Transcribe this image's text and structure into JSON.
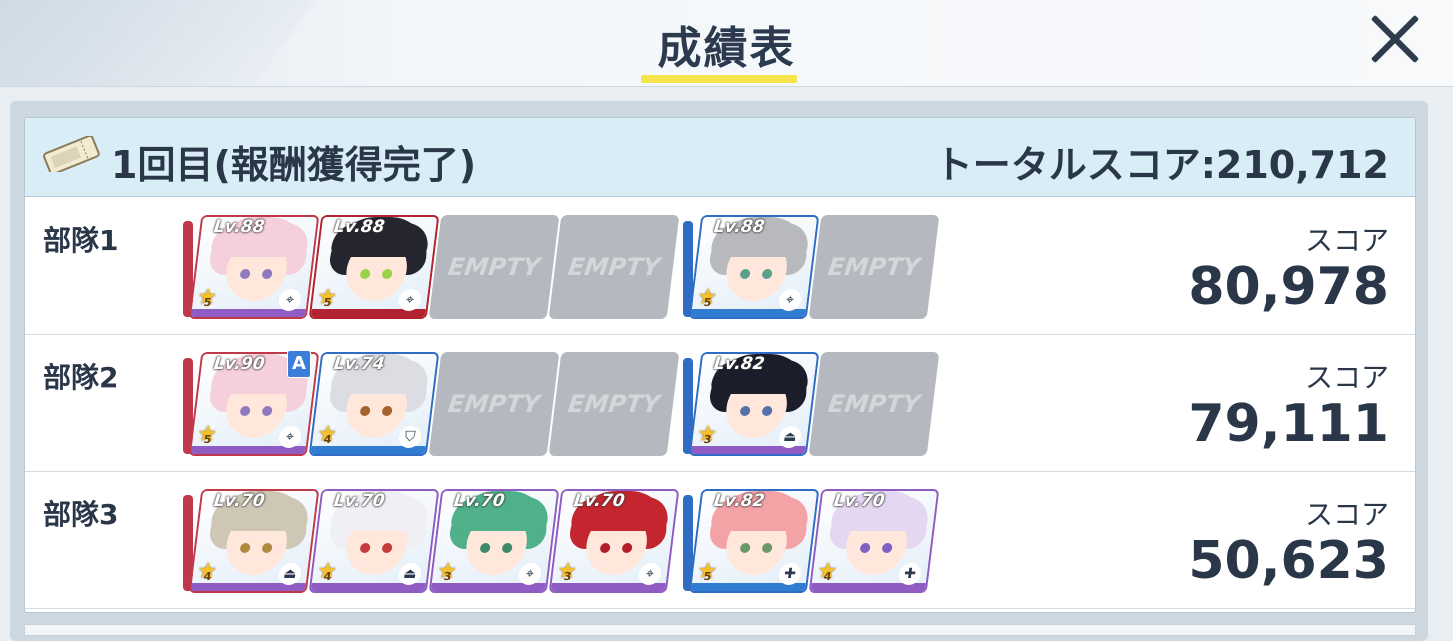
{
  "header": {
    "title": "成績表"
  },
  "round": {
    "label": "1回目(報酬獲得完了)",
    "total_score": "トータルスコア:210,712"
  },
  "empty_label": "EMPTY",
  "teams": [
    {
      "label": "部隊1",
      "score_caption": "スコア",
      "score": "80,978",
      "slots": [
        {
          "type": "char",
          "level": "Lv.88",
          "stars": "5",
          "role": "crosshair",
          "hair": "#f6cfdc",
          "eyes": "#8f7ac0",
          "frame": "#c0394b",
          "bar": "#8e5cc3"
        },
        {
          "type": "char",
          "level": "Lv.88",
          "stars": "5",
          "role": "crosshair",
          "hair": "#252530",
          "eyes": "#9bd04a",
          "frame": "#b2222f",
          "bar": "#b2222f"
        },
        {
          "type": "empty"
        },
        {
          "type": "empty"
        },
        {
          "type": "char",
          "level": "Lv.88",
          "stars": "5",
          "role": "crosshair",
          "hair": "#b7b9bd",
          "eyes": "#5aa08a",
          "frame": "#2f6cc4",
          "bar": "#2f7cd1"
        },
        {
          "type": "empty"
        }
      ]
    },
    {
      "label": "部隊2",
      "score_caption": "スコア",
      "score": "79,111",
      "badge": "A",
      "slots": [
        {
          "type": "char",
          "level": "Lv.90",
          "stars": "5",
          "role": "crosshair",
          "hair": "#f6cfdc",
          "eyes": "#8f7ac0",
          "frame": "#c0394b",
          "bar": "#8e5cc3"
        },
        {
          "type": "char",
          "level": "Lv.74",
          "stars": "4",
          "role": "shield",
          "hair": "#dcdde3",
          "eyes": "#a4632a",
          "frame": "#2f6cc4",
          "bar": "#2f7cd1"
        },
        {
          "type": "empty"
        },
        {
          "type": "empty"
        },
        {
          "type": "char",
          "level": "Lv.82",
          "stars": "3",
          "role": "support",
          "hair": "#1b1d2a",
          "eyes": "#5670a8",
          "frame": "#2f6cc4",
          "bar": "#8e5cc3"
        },
        {
          "type": "empty"
        }
      ]
    },
    {
      "label": "部隊3",
      "score_caption": "スコア",
      "score": "50,623",
      "slots": [
        {
          "type": "char",
          "level": "Lv.70",
          "stars": "4",
          "role": "support",
          "hair": "#cfc7b5",
          "eyes": "#b08a40",
          "frame": "#c0394b",
          "bar": "#8e5cc3"
        },
        {
          "type": "char",
          "level": "Lv.70",
          "stars": "4",
          "role": "support",
          "hair": "#f0f0f4",
          "eyes": "#c23a3a",
          "frame": "#8e5cc3",
          "bar": "#8e5cc3"
        },
        {
          "type": "char",
          "level": "Lv.70",
          "stars": "3",
          "role": "crosshair",
          "hair": "#4fb08a",
          "eyes": "#3c8a6a",
          "frame": "#8e5cc3",
          "bar": "#8e5cc3"
        },
        {
          "type": "char",
          "level": "Lv.70",
          "stars": "3",
          "role": "crosshair",
          "hair": "#c3262f",
          "eyes": "#b21f2a",
          "frame": "#8e5cc3",
          "bar": "#8e5cc3"
        },
        {
          "type": "char",
          "level": "Lv.82",
          "stars": "5",
          "role": "heal",
          "hair": "#f3a2a6",
          "eyes": "#6a9a6a",
          "frame": "#2f6cc4",
          "bar": "#2f7cd1"
        },
        {
          "type": "char",
          "level": "Lv.70",
          "stars": "4",
          "role": "heal",
          "hair": "#e4d7f2",
          "eyes": "#8060c0",
          "frame": "#8e5cc3",
          "bar": "#8e5cc3"
        }
      ]
    }
  ]
}
